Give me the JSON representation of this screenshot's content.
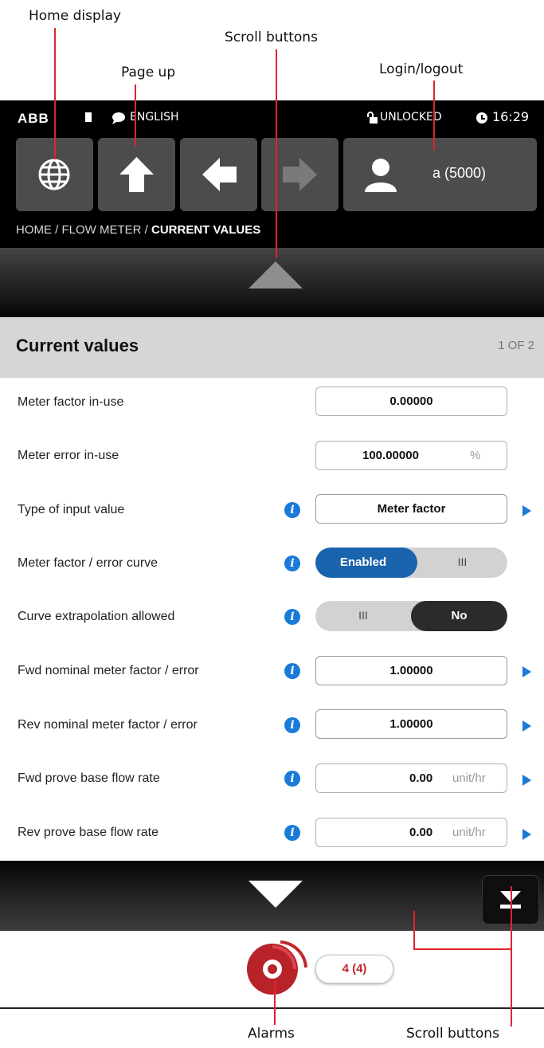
{
  "annotations": {
    "home_display": "Home display",
    "scroll_buttons_top": "Scroll buttons",
    "page_up": "Page up",
    "login_logout": "Login/logout",
    "alarms": "Alarms",
    "scroll_buttons_bottom": "Scroll buttons",
    "line_color": "#e0252b"
  },
  "status_bar": {
    "brand": "ABB",
    "language": "ENGLISH",
    "lock_status": "UNLOCKED",
    "time": "16:29"
  },
  "toolbar": {
    "home_icon": "globe-icon",
    "page_up_icon": "arrow-up-icon",
    "back_icon": "arrow-left-icon",
    "forward_icon": "arrow-right-icon",
    "user_icon": "user-icon",
    "user_label": "a (5000)"
  },
  "breadcrumb": {
    "prefix": "HOME / FLOW METER / ",
    "current": "CURRENT VALUES"
  },
  "page": {
    "title": "Current values",
    "indicator": "1 OF 2"
  },
  "rows": [
    {
      "label": "Meter factor in-use",
      "value": "0.00000",
      "unit": ""
    },
    {
      "label": "Meter error in-use",
      "value": "100.00000",
      "unit": "%"
    },
    {
      "label": "Type of input value",
      "value": "Meter factor",
      "unit": ""
    },
    {
      "label": "Meter factor / error curve",
      "toggle_on": "Enabled",
      "toggle_off": "III"
    },
    {
      "label": "Curve extrapolation allowed",
      "toggle_on": "No",
      "toggle_off": "III"
    },
    {
      "label": "Fwd nominal meter factor / error",
      "value": "1.00000",
      "unit": ""
    },
    {
      "label": "Rev nominal meter factor / error",
      "value": "1.00000",
      "unit": ""
    },
    {
      "label": "Fwd prove base flow rate",
      "value": "0.00",
      "unit": "unit/hr"
    },
    {
      "label": "Rev prove base flow rate",
      "value": "0.00",
      "unit": "unit/hr"
    }
  ],
  "alarms": {
    "count": "4 (4)",
    "icon": "alarm-bell-icon"
  },
  "colors": {
    "accent": "#1a7ad8",
    "alarm": "#c0272d"
  }
}
